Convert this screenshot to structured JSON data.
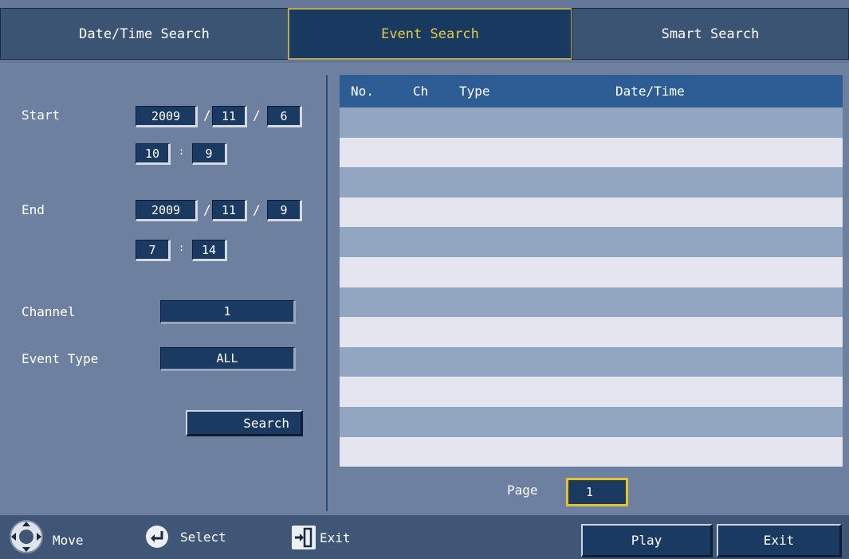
{
  "tabs": [
    {
      "label": "Date/Time Search",
      "active": false
    },
    {
      "label": "Event Search",
      "active": true
    },
    {
      "label": "Smart Search",
      "active": false
    }
  ],
  "form": {
    "start_label": "Start",
    "start": {
      "year": "2009",
      "month": "11",
      "day": "6",
      "hour": "10",
      "minute": "9"
    },
    "end_label": "End",
    "end": {
      "year": "2009",
      "month": "11",
      "day": "9",
      "hour": "7",
      "minute": "14"
    },
    "date_sep": "/",
    "time_sep": ":",
    "channel_label": "Channel",
    "channel_value": "1",
    "event_type_label": "Event Type",
    "event_type_value": "ALL",
    "search_button": "Search"
  },
  "table": {
    "columns": [
      "No.",
      "Ch",
      "Type",
      "Date/Time"
    ],
    "row_count": 12,
    "rows": []
  },
  "pager": {
    "label": "Page",
    "value": "1"
  },
  "footer": {
    "move": "Move",
    "select": "Select",
    "exit_hint": "Exit",
    "play_button": "Play",
    "exit_button": "Exit"
  },
  "colors": {
    "active_tab_text": "#e7cb44",
    "table_header": "#2e5d96",
    "row_dark": "#93a6c1",
    "row_light": "#e4e5ee",
    "focus_border": "#e7c02a"
  }
}
